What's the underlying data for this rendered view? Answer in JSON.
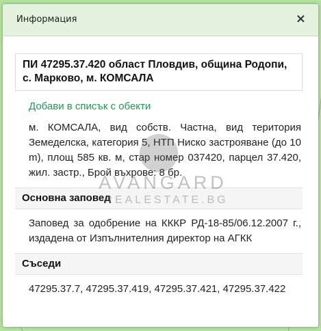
{
  "dialog": {
    "title": "Информация",
    "close_label": "×"
  },
  "property": {
    "heading": "ПИ 47295.37.420 област Пловдив, община Родопи, с. Марково, м. КОМСАЛА",
    "add_link": "Добави в списък с обекти",
    "description": "м. КОМСАЛА, вид собств. Частна, вид територия Земеделска, категория 5, НТП Ниско застрояване (до 10 m), площ 585 кв. м, стар номер 037420, парцел 37.420, жил. застр., Брой въхрове: 8 бр."
  },
  "order": {
    "heading": "Основна заповед",
    "text": "Заповед за одобрение на КККР РД-18-85/06.12.2007 г., издадена от Изпълнителния директор на АГКК"
  },
  "neighbors": {
    "heading": "Съседи",
    "text": "47295.37.7, 47295.37.419, 47295.37.421, 47295.37.422"
  },
  "watermark": {
    "brand": "AVANGARD",
    "sub": "REALESTATE.BG"
  }
}
